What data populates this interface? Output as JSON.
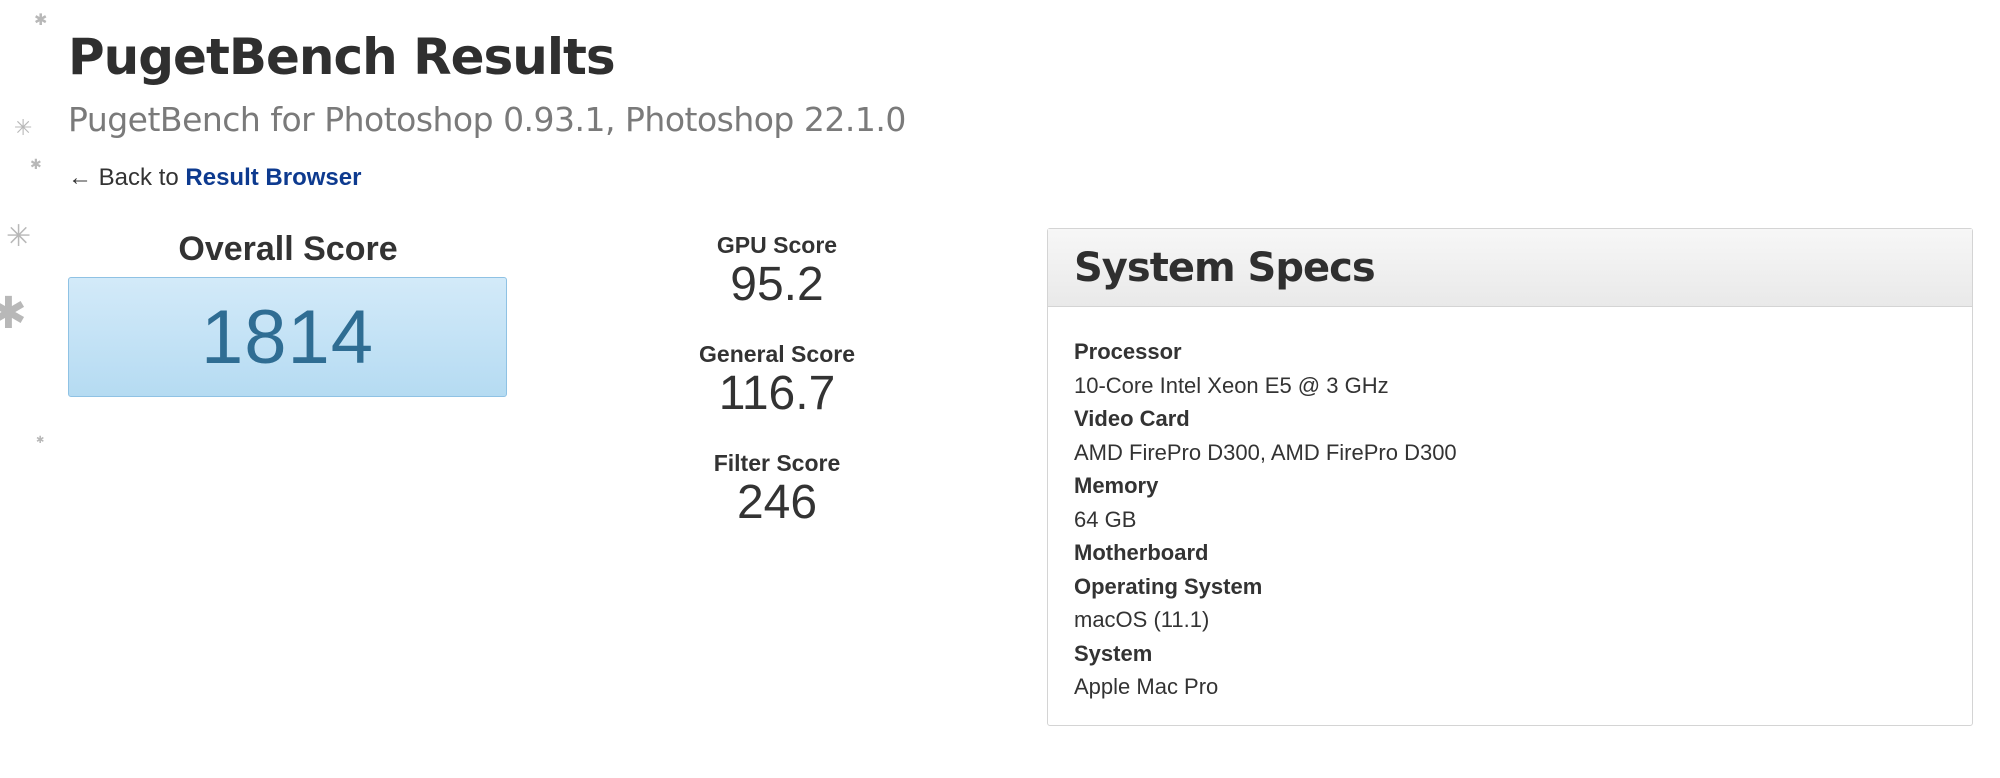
{
  "page": {
    "title": "PugetBench Results",
    "subtitle": "PugetBench for Photoshop 0.93.1, Photoshop 22.1.0"
  },
  "nav": {
    "back_prefix": "← Back to",
    "back_link_label": "Result Browser"
  },
  "overall": {
    "label": "Overall Score",
    "value": "1814"
  },
  "scores": [
    {
      "label": "GPU Score",
      "value": "95.2"
    },
    {
      "label": "General Score",
      "value": "116.7"
    },
    {
      "label": "Filter Score",
      "value": "246"
    }
  ],
  "specs": {
    "title": "System Specs",
    "processor_label": "Processor",
    "processor_value": "10-Core Intel Xeon E5 @ 3 GHz",
    "video_card_label": "Video Card",
    "video_card_value": "AMD FirePro D300, AMD FirePro D300",
    "memory_label": "Memory",
    "memory_value": "64 GB",
    "motherboard_label": "Motherboard",
    "os_label": "Operating System",
    "os_value": "macOS (11.1)",
    "system_label": "System",
    "system_value": "Apple Mac Pro"
  },
  "colors": {
    "link": "#0d3a8f",
    "overall_text": "#2f6d93",
    "overall_box": "#b5dbf2"
  }
}
